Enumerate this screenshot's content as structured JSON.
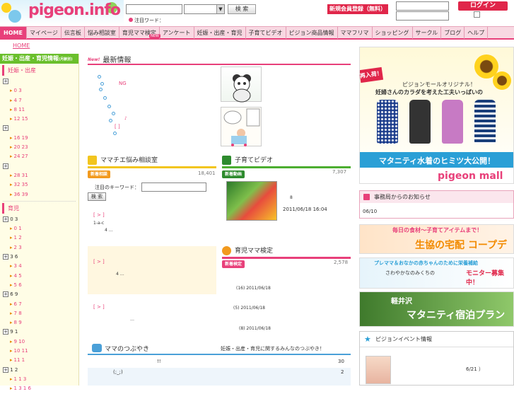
{
  "header": {
    "logo_text": "pigeon.info",
    "search_button": "検 索",
    "hot_label": "注目ワード：",
    "register_button": "新規会員登録（無料）",
    "login_button": "ログイン"
  },
  "nav": {
    "items": [
      "HOME",
      "マイページ",
      "伝言板",
      "悩み相談室",
      "育児ママ検定",
      "アンケート",
      "妊娠・出産・育児",
      "子育てビデオ",
      "ピジョン商品情報",
      "ママフリマ",
      "ショッピング",
      "サークル",
      "ブログ",
      "ヘルプ"
    ],
    "new_badge": "NEW"
  },
  "breadcrumb": "HOME",
  "top_link": "",
  "sidebar": {
    "title": "妊娠・出産・育児情報",
    "title_small": "(月齢別)",
    "section1": "妊娠・出産",
    "section2": "育児",
    "items_a": [
      "0 3",
      "4 7",
      "8 11",
      "12 15"
    ],
    "items_b": [
      "16 19",
      "20 23",
      "24 27"
    ],
    "items_c": [
      "28 31",
      "32 35",
      "36 39"
    ],
    "items_d": [
      "0 3",
      "0 1",
      "1 2",
      "2 3"
    ],
    "items_e": [
      "3 6",
      "3 4",
      "4 5",
      "5 6"
    ],
    "items_f": [
      "6 9",
      "6 7",
      "7 8",
      "8 9"
    ],
    "items_g": [
      "9 1",
      "9 10",
      "10 11",
      "11 1"
    ],
    "items_h": [
      "1 2",
      "1 1 3",
      "1 3 1 6"
    ]
  },
  "main": {
    "latest_new": "New!",
    "latest_title": "最新情報",
    "ng_text": "NG",
    "bracket_text": "[ ]",
    "consult_title": "ママチエ悩み相談室",
    "consult_badge": "新着相談",
    "consult_count": "18,401",
    "keyword_label": "注目のキーワード：",
    "keyword_button": "検 索",
    "video_title": "子育てビデオ",
    "video_badge": "新着動画",
    "video_count": "7,307",
    "video_num": "8",
    "video_date": "2011/06/18 16:04",
    "exam_title": "育児ママ検定",
    "exam_badge": "新着検定",
    "exam_count": "2,578",
    "exam_rows": [
      "(16) 2011/06/18",
      "(5) 2011/06/18",
      "(8) 2011/06/18"
    ],
    "consult_rows": [
      "[ > ]",
      "1-a-c",
      "4 …",
      "[ > ]",
      "4 …",
      "[ > ]",
      "…"
    ],
    "tweet_title": "ママのつぶやき",
    "tweet_sub": "妊娠・出産・育児に関するみんなのつぶやき！",
    "tweet_row1_mark": "!!",
    "tweet_row1_count": "30",
    "tweet_row2_text": "(;_;)",
    "tweet_row2_count": "2"
  },
  "right": {
    "ad_reissue": "再入荷！",
    "ad_line1": "ピジョンモールオリジナル！",
    "ad_line2": "妊婦さんのカラダを考えた工夫いっぱいの",
    "ad_bar": "マタニティ水着のヒミツ大公開！",
    "ad_mall": "pigeon mall",
    "notice_title": "事務局からのお知らせ",
    "notice_date": "06/10",
    "ban1_t1": "毎日の食材～子育てアイテムまで！",
    "ban1_t2": "生協の宅配 コープデリ",
    "ban2_t1": "プレママ＆おなかの赤ちゃんのために栄養補給",
    "ban2_t2": "モニター募集中！",
    "ban2_t3": "さわやかなのみくちの",
    "ban3_t1": "軽井沢",
    "ban3_t2": "マタニティ宿泊プラン",
    "event_title": "ピジョンイベント情報",
    "event_date": "6/21 ）"
  }
}
